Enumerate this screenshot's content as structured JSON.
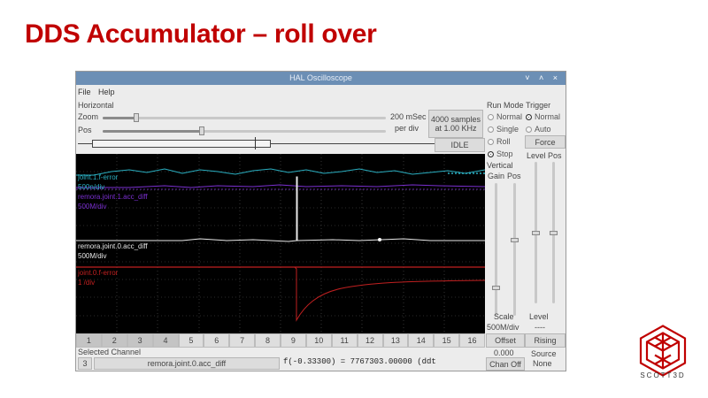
{
  "slide": {
    "title": "DDS Accumulator – roll over"
  },
  "window": {
    "title": "HAL Oscilloscope",
    "controls": "˅ ˄ ×",
    "menu": [
      "File",
      "Help"
    ]
  },
  "horizontal": {
    "group_label": "Horizontal",
    "zoom_label": "Zoom",
    "pos_label": "Pos",
    "zoom_level": 0.12,
    "pos_level": 0.35,
    "time_per_div_1": "200 mSec",
    "time_per_div_2": "per div",
    "samples_1": "4000 samples",
    "samples_2": "at 1.00 KHz",
    "state": "IDLE"
  },
  "run_mode": {
    "label": "Run Mode",
    "options": [
      "Normal",
      "Single",
      "Roll",
      "Stop"
    ],
    "selected": "Stop"
  },
  "trigger": {
    "label": "Trigger",
    "options": [
      "Normal",
      "Auto"
    ],
    "selected": "Normal",
    "force_label": "Force",
    "level_col_label": "Level",
    "pos_col_label": "Pos",
    "level_label": "Level",
    "level_value": "----",
    "edge": "Rising",
    "source_label": "Source",
    "source_value": "None"
  },
  "vertical": {
    "label": "Vertical",
    "gain_label": "Gain",
    "pos_label": "Pos",
    "scale_label": "Scale",
    "scale_value": "500M/div",
    "offset_label": "Offset",
    "offset_value": "0.000",
    "chan_off": "Chan Off"
  },
  "traces": [
    {
      "name": "joint.1.f-error",
      "scale": "500n/div",
      "color": "#2bb0c2"
    },
    {
      "name": "remora.joint.1.acc_diff",
      "scale": "500M/div",
      "color": "#7a2fd0"
    },
    {
      "name": "remora.joint.0.acc_diff",
      "scale": "500M/div",
      "color": "#e8e8e8"
    },
    {
      "name": "joint.0.f-error",
      "scale": "1 /div",
      "color": "#c02020"
    }
  ],
  "channels": [
    "1",
    "2",
    "3",
    "4",
    "5",
    "6",
    "7",
    "8",
    "9",
    "10",
    "11",
    "12",
    "13",
    "14",
    "15",
    "16"
  ],
  "selected_channel": {
    "label": "Selected Channel",
    "number": "3",
    "name": "remora.joint.0.acc_diff"
  },
  "status_line": "f(-0.33300) =  7767303.00000 (ddt",
  "brand": {
    "name": "SCOTT3D",
    "color": "#c00000"
  }
}
